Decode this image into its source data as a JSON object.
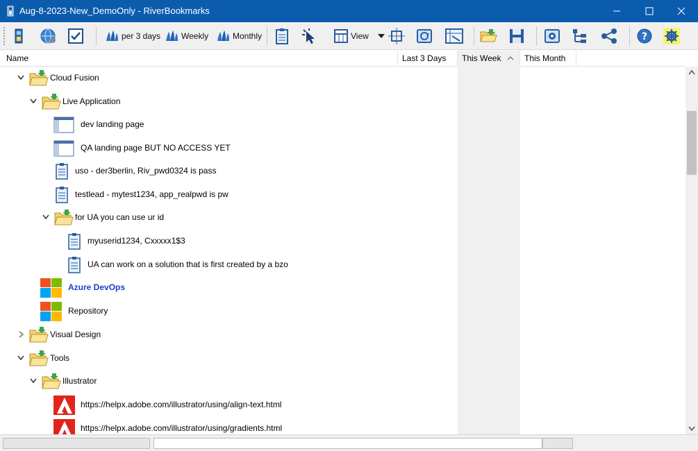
{
  "window": {
    "title": "Aug-8-2023-New_DemoOnly - RiverBookmarks",
    "controls": [
      "minimize",
      "maximize",
      "close"
    ]
  },
  "toolbar": {
    "per3days_label": "per 3 days",
    "weekly_label": "Weekly",
    "monthly_label": "Monthly",
    "view_label": "View"
  },
  "columns": {
    "name": "Name",
    "last3days": "Last 3 Days",
    "this_week": "This Week",
    "this_month": "This Month"
  },
  "tree": {
    "rows": [
      {
        "label": "Cloud Fusion",
        "icon": "folder-open-icon",
        "expanded": true
      },
      {
        "label": "Live Application",
        "icon": "folder-open-icon",
        "expanded": true
      },
      {
        "label": "dev landing page",
        "icon": "webpage-icon"
      },
      {
        "label": "QA landing page BUT NO ACCESS YET",
        "icon": "webpage-icon"
      },
      {
        "label": "uso - der3berlin, Riv_pwd0324 is pass",
        "icon": "note-icon"
      },
      {
        "label": "testlead - mytest1234, app_realpwd is pw",
        "icon": "note-icon"
      },
      {
        "label": "for UA you can use ur id",
        "icon": "folder-open-icon",
        "expanded": true
      },
      {
        "label": "myuserid1234, Cxxxxx1$3",
        "icon": "note-icon"
      },
      {
        "label": "UA can work on a solution that is first created by a bzo",
        "icon": "note-icon"
      },
      {
        "label": "Azure DevOps",
        "icon": "windows-logo-icon",
        "highlight": true
      },
      {
        "label": "Repository",
        "icon": "windows-logo-icon"
      },
      {
        "label": "Visual Design",
        "icon": "folder-open-icon",
        "expanded": false
      },
      {
        "label": "Tools",
        "icon": "folder-open-icon",
        "expanded": true
      },
      {
        "label": "Illustrator",
        "icon": "folder-open-icon",
        "expanded": true
      },
      {
        "label": "https://helpx.adobe.com/illustrator/using/align-text.html",
        "icon": "adobe-icon"
      },
      {
        "label": "https://helpx.adobe.com/illustrator/using/gradients.html",
        "icon": "adobe-icon"
      }
    ]
  },
  "colors": {
    "titlebar": "#0b5cad",
    "link": "#1f3fcc",
    "sorted_column": "#f0f0f0"
  }
}
